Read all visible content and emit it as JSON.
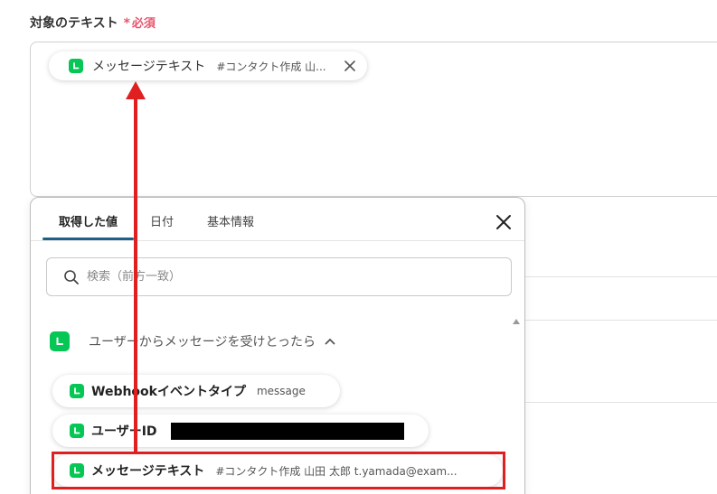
{
  "field": {
    "label": "対象のテキスト",
    "required_star": "*",
    "required_text": "必須",
    "selected_chip": {
      "name": "メッセージテキスト",
      "value": "#コンタクト作成 山..."
    }
  },
  "popup": {
    "tabs": [
      {
        "label": "取得した値",
        "active": true
      },
      {
        "label": "日付",
        "active": false
      },
      {
        "label": "基本情報",
        "active": false
      }
    ],
    "search": {
      "placeholder": "検索（前方一致）",
      "value": ""
    },
    "group": {
      "title": "ユーザーからメッセージを受けとったら",
      "expanded": true
    },
    "items": [
      {
        "name": "Webhookイベントタイプ",
        "value": "message"
      },
      {
        "name": "ユーザーID",
        "value": ""
      },
      {
        "name": "メッセージテキスト",
        "value": "#コンタクト作成 山田 太郎 t.yamada@exam..."
      }
    ]
  },
  "colors": {
    "line_green": "#06c755",
    "required_red": "#e8556b",
    "annotation_red": "#e02020",
    "tab_underline": "#1e5f85"
  },
  "icons": {
    "app_icon": "line-app-icon",
    "remove": "close-icon",
    "search": "search-icon",
    "collapse": "chevron-up-icon"
  }
}
